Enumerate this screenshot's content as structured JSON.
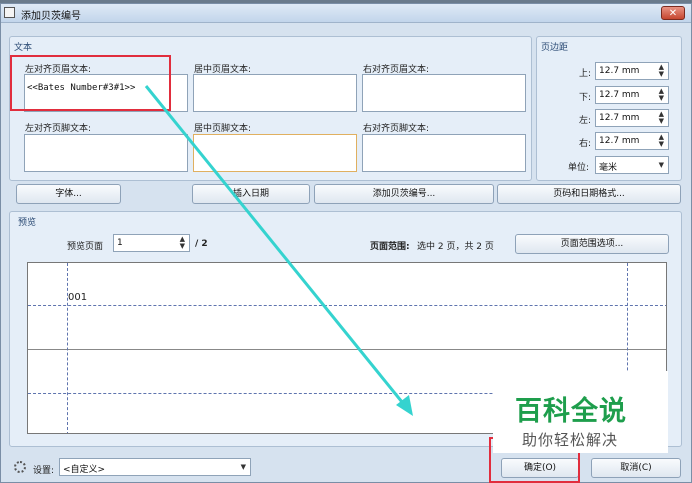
{
  "window": {
    "title": "添加贝茨编号",
    "close_label": "✕"
  },
  "text_panel": {
    "title": "文本",
    "left_header_label": "左对齐页眉文本:",
    "left_header_value": "<<Bates Number#3#1>>",
    "center_header_label": "居中页眉文本:",
    "center_header_value": "",
    "right_header_label": "右对齐页眉文本:",
    "right_header_value": "",
    "left_footer_label": "左对齐页脚文本:",
    "left_footer_value": "",
    "center_footer_label": "居中页脚文本:",
    "center_footer_value": "",
    "right_footer_label": "右对齐页脚文本:",
    "right_footer_value": ""
  },
  "margin_panel": {
    "title": "页边距",
    "top_label": "上:",
    "top_value": "12.7 mm",
    "bottom_label": "下:",
    "bottom_value": "12.7 mm",
    "left_label": "左:",
    "left_value": "12.7 mm",
    "right_label": "右:",
    "right_value": "12.7 mm",
    "unit_label": "单位:",
    "unit_value": "毫米"
  },
  "action_buttons": {
    "font": "字体...",
    "insert_date": "插入日期",
    "add_bates": "添加贝茨编号...",
    "page_date_format": "页码和日期格式..."
  },
  "preview_panel": {
    "title": "预览",
    "preview_page_label": "预览页面",
    "preview_page_value": "1",
    "preview_page_total": "/ 2",
    "page_range_label": "页面范围:",
    "page_range_text": "选中 2 页，共 2 页",
    "page_range_options": "页面范围选项...",
    "preview_sample_text": "001"
  },
  "footer": {
    "settings_label": "设置:",
    "settings_value": "<自定义>",
    "ok": "确定(O)",
    "cancel": "取消(C)"
  },
  "watermark": {
    "title": "百科全说",
    "subtitle": "助你轻松解决"
  },
  "icons": [
    "window-icon",
    "close-icon",
    "spin-arrows-icon",
    "dropdown-arrow-icon",
    "settings-gear-icon"
  ],
  "colors": {
    "highlight_red": "#e12d3d",
    "arrow_cyan": "#35d3cf",
    "watermark_green": "#1e9e4c",
    "guide_blue": "#5f74ae"
  }
}
